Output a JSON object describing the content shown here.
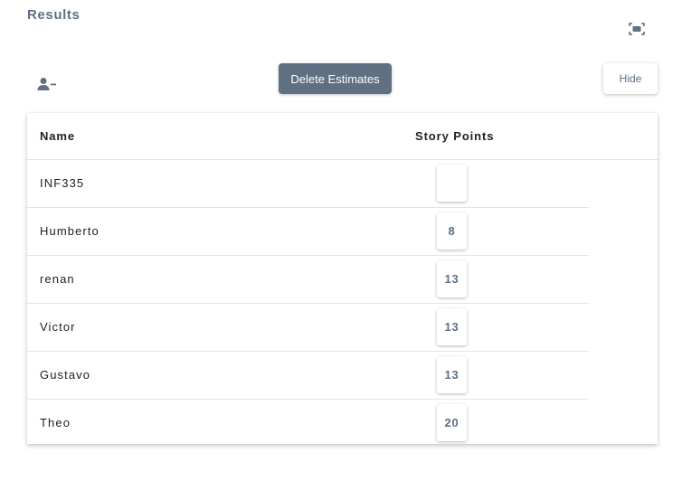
{
  "page": {
    "title": "Results"
  },
  "toolbar": {
    "delete_label": "Delete Estimates",
    "hide_label": "Hide",
    "remove_user_icon": "person-remove-icon",
    "fullscreen_icon": "fullscreen-icon"
  },
  "table": {
    "headers": {
      "name": "Name",
      "points": "Story Points"
    },
    "rows": [
      {
        "name": "INF335",
        "points": ""
      },
      {
        "name": "Humberto",
        "points": "8"
      },
      {
        "name": "renan",
        "points": "13"
      },
      {
        "name": "Victor",
        "points": "13"
      },
      {
        "name": "Gustavo",
        "points": "13"
      },
      {
        "name": "Theo",
        "points": "20"
      }
    ]
  },
  "colors": {
    "accent": "#5f7082",
    "text": "#212121",
    "divider": "#e3e3e3"
  }
}
